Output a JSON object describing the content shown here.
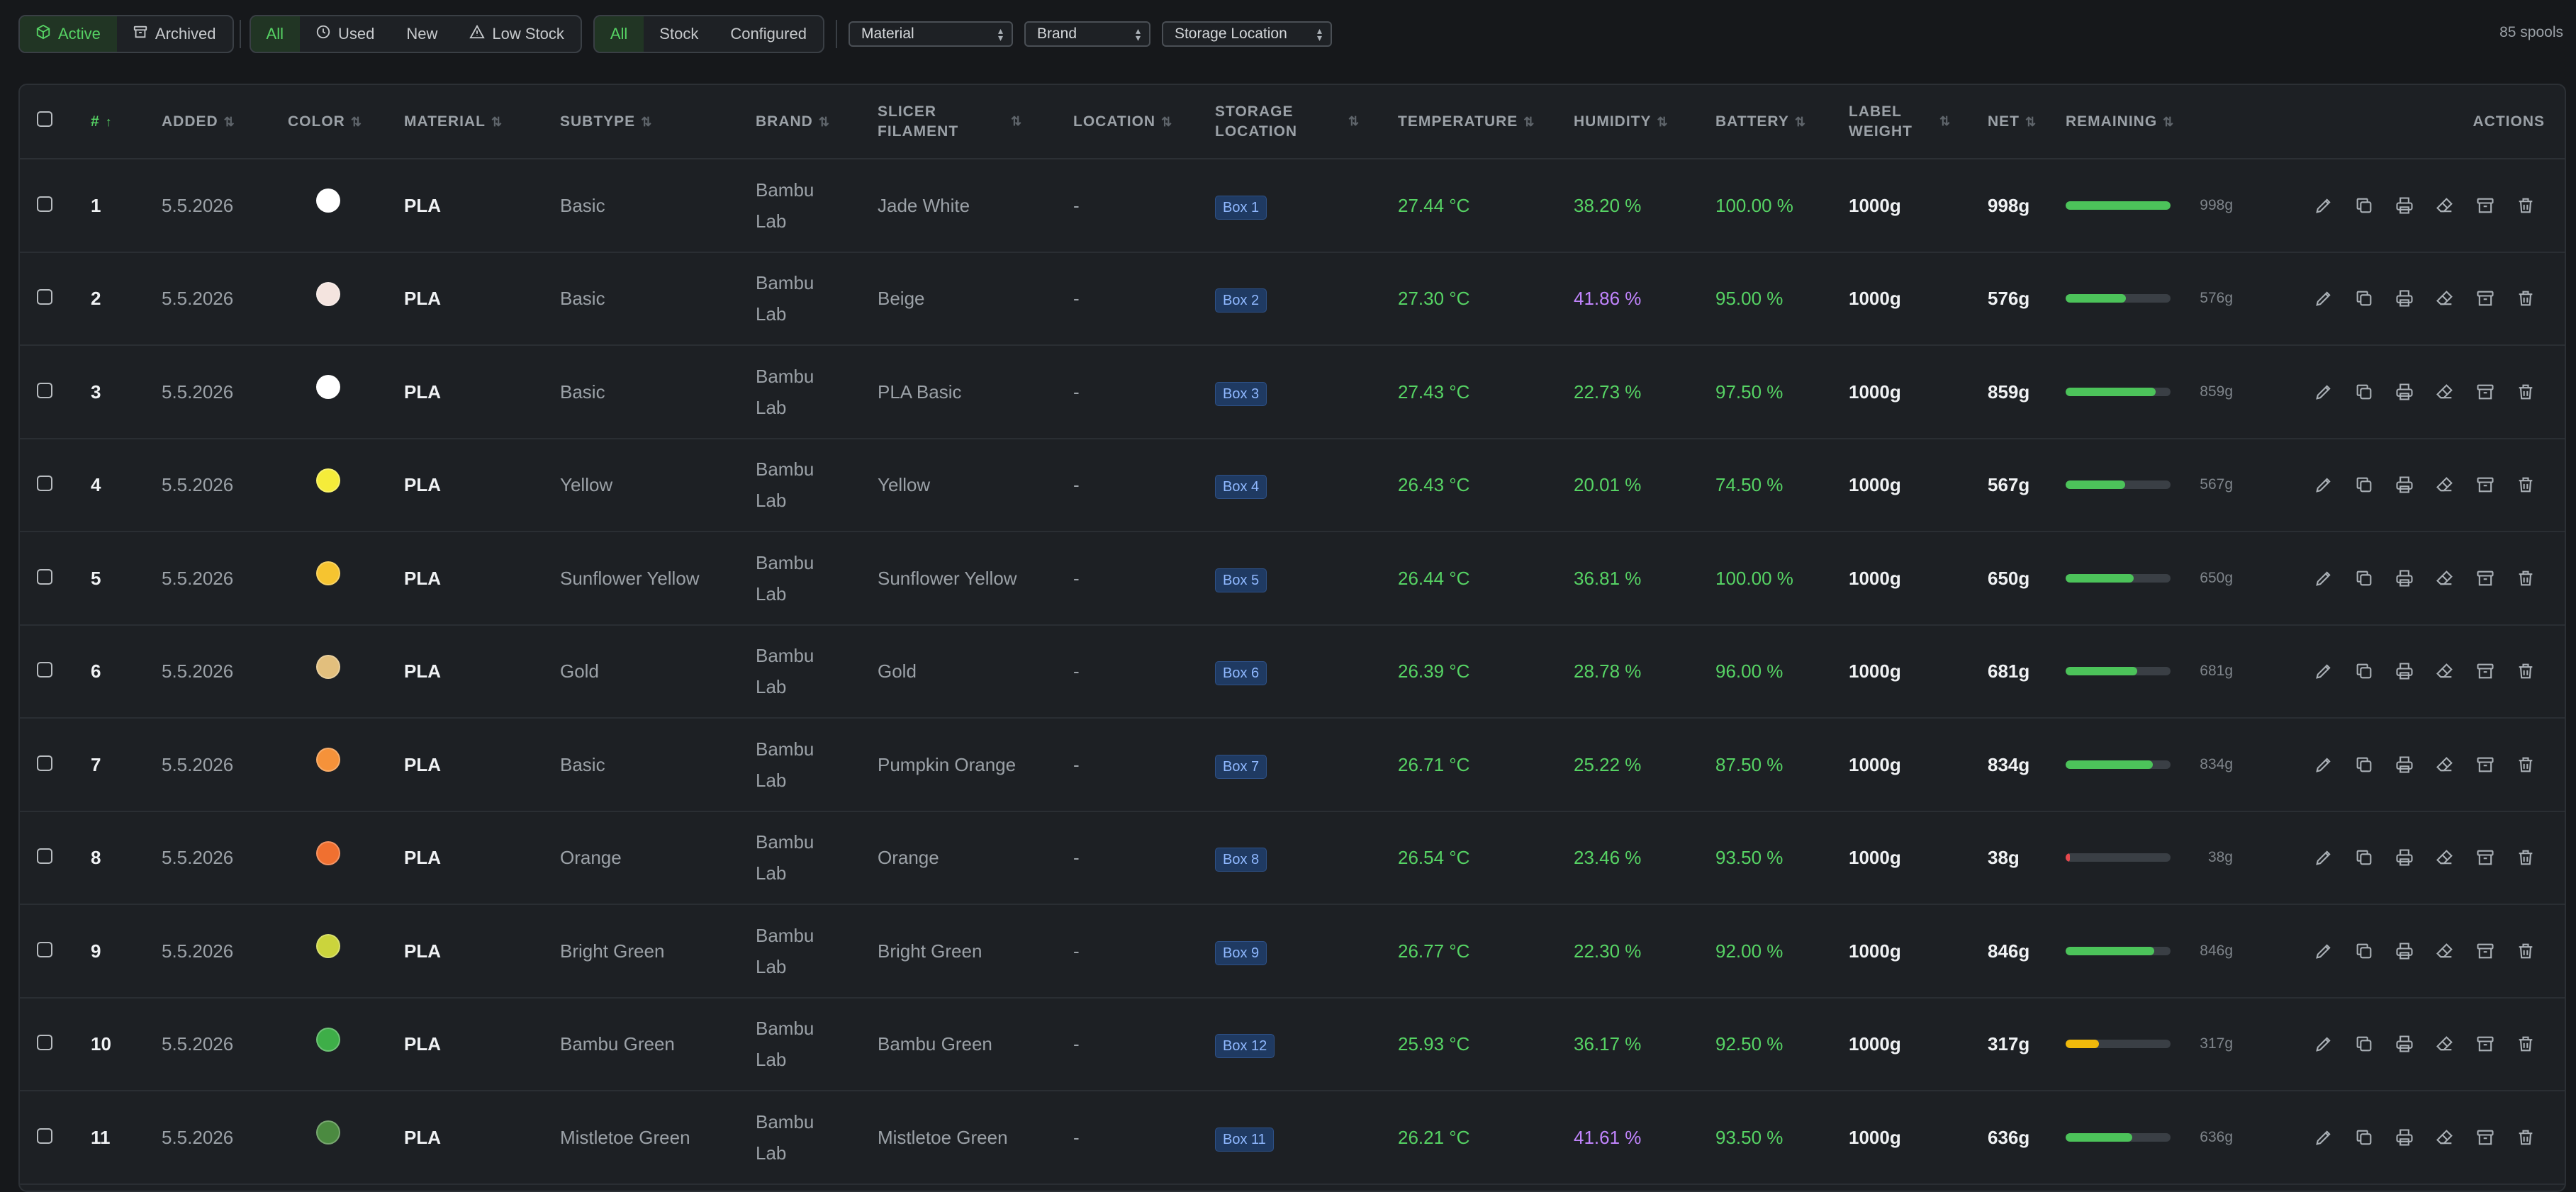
{
  "filters": {
    "status": [
      {
        "label": "Active",
        "icon": "cube-icon",
        "active": true
      },
      {
        "label": "Archived",
        "icon": "archive-icon",
        "active": false
      }
    ],
    "usage": [
      {
        "label": "All",
        "icon": "",
        "active": true
      },
      {
        "label": "Used",
        "icon": "clock-icon",
        "active": false
      },
      {
        "label": "New",
        "icon": "",
        "active": false
      },
      {
        "label": "Low Stock",
        "icon": "warning-icon",
        "active": false
      }
    ],
    "config": [
      {
        "label": "All",
        "active": true
      },
      {
        "label": "Stock",
        "active": false
      },
      {
        "label": "Configured",
        "active": false
      }
    ],
    "selects": [
      {
        "label": "Material"
      },
      {
        "label": "Brand"
      },
      {
        "label": "Storage Location"
      }
    ],
    "count": "85 spools"
  },
  "columns": {
    "id": "#",
    "added": "Added",
    "color": "Color",
    "material": "Material",
    "subtype": "Subtype",
    "brand": "Brand",
    "slicer": "Slicer Filament",
    "location": "Location",
    "storage": "Storage Location",
    "temperature": "Temperature",
    "humidity": "Humidity",
    "battery": "Battery",
    "label_weight": "Label Weight",
    "net": "Net",
    "remaining": "Remaining",
    "actions": "Actions"
  },
  "colors": {
    "accent": "#56d364",
    "humidity_high": "#c084fc",
    "bar_ok": "#4cc35a",
    "bar_warn": "#f0b90b",
    "bar_low": "#e5484d"
  },
  "rows": [
    {
      "id": "1",
      "added": "5.5.2026",
      "color": "#ffffff",
      "material": "PLA",
      "subtype": "Basic",
      "brand": "Bambu Lab",
      "slicer": "Jade White",
      "location": "-",
      "storage": "Box 1",
      "temperature": "27.44 °C",
      "humidity": "38.20 %",
      "hum_high": false,
      "battery": "100.00 %",
      "label_weight": "1000g",
      "net": "998g",
      "remaining": 0.998,
      "remaining_label": "998g"
    },
    {
      "id": "2",
      "added": "5.5.2026",
      "color": "#f4e4df",
      "material": "PLA",
      "subtype": "Basic",
      "brand": "Bambu Lab",
      "slicer": "Beige",
      "location": "-",
      "storage": "Box 2",
      "temperature": "27.30 °C",
      "humidity": "41.86 %",
      "hum_high": true,
      "battery": "95.00 %",
      "label_weight": "1000g",
      "net": "576g",
      "remaining": 0.576,
      "remaining_label": "576g"
    },
    {
      "id": "3",
      "added": "5.5.2026",
      "color": "#ffffff",
      "material": "PLA",
      "subtype": "Basic",
      "brand": "Bambu Lab",
      "slicer": "PLA Basic",
      "location": "-",
      "storage": "Box 3",
      "temperature": "27.43 °C",
      "humidity": "22.73 %",
      "hum_high": false,
      "battery": "97.50 %",
      "label_weight": "1000g",
      "net": "859g",
      "remaining": 0.859,
      "remaining_label": "859g"
    },
    {
      "id": "4",
      "added": "5.5.2026",
      "color": "#f5ec3a",
      "material": "PLA",
      "subtype": "Yellow",
      "brand": "Bambu Lab",
      "slicer": "Yellow",
      "location": "-",
      "storage": "Box 4",
      "temperature": "26.43 °C",
      "humidity": "20.01 %",
      "hum_high": false,
      "battery": "74.50 %",
      "label_weight": "1000g",
      "net": "567g",
      "remaining": 0.567,
      "remaining_label": "567g"
    },
    {
      "id": "5",
      "added": "5.5.2026",
      "color": "#f6c430",
      "material": "PLA",
      "subtype": "Sunflower Yellow",
      "brand": "Bambu Lab",
      "slicer": "Sunflower Yellow",
      "location": "-",
      "storage": "Box 5",
      "temperature": "26.44 °C",
      "humidity": "36.81 %",
      "hum_high": false,
      "battery": "100.00 %",
      "label_weight": "1000g",
      "net": "650g",
      "remaining": 0.65,
      "remaining_label": "650g"
    },
    {
      "id": "6",
      "added": "5.5.2026",
      "color": "#e2bf7d",
      "material": "PLA",
      "subtype": "Gold",
      "brand": "Bambu Lab",
      "slicer": "Gold",
      "location": "-",
      "storage": "Box 6",
      "temperature": "26.39 °C",
      "humidity": "28.78 %",
      "hum_high": false,
      "battery": "96.00 %",
      "label_weight": "1000g",
      "net": "681g",
      "remaining": 0.681,
      "remaining_label": "681g"
    },
    {
      "id": "7",
      "added": "5.5.2026",
      "color": "#f5923a",
      "material": "PLA",
      "subtype": "Basic",
      "brand": "Bambu Lab",
      "slicer": "Pumpkin Orange",
      "location": "-",
      "storage": "Box 7",
      "temperature": "26.71 °C",
      "humidity": "25.22 %",
      "hum_high": false,
      "battery": "87.50 %",
      "label_weight": "1000g",
      "net": "834g",
      "remaining": 0.834,
      "remaining_label": "834g"
    },
    {
      "id": "8",
      "added": "5.5.2026",
      "color": "#f07030",
      "material": "PLA",
      "subtype": "Orange",
      "brand": "Bambu Lab",
      "slicer": "Orange",
      "location": "-",
      "storage": "Box 8",
      "temperature": "26.54 °C",
      "humidity": "23.46 %",
      "hum_high": false,
      "battery": "93.50 %",
      "label_weight": "1000g",
      "net": "38g",
      "remaining": 0.038,
      "remaining_label": "38g"
    },
    {
      "id": "9",
      "added": "5.5.2026",
      "color": "#cbd43c",
      "material": "PLA",
      "subtype": "Bright Green",
      "brand": "Bambu Lab",
      "slicer": "Bright Green",
      "location": "-",
      "storage": "Box 9",
      "temperature": "26.77 °C",
      "humidity": "22.30 %",
      "hum_high": false,
      "battery": "92.00 %",
      "label_weight": "1000g",
      "net": "846g",
      "remaining": 0.846,
      "remaining_label": "846g"
    },
    {
      "id": "10",
      "added": "5.5.2026",
      "color": "#3eae48",
      "material": "PLA",
      "subtype": "Bambu Green",
      "brand": "Bambu Lab",
      "slicer": "Bambu Green",
      "location": "-",
      "storage": "Box 12",
      "temperature": "25.93 °C",
      "humidity": "36.17 %",
      "hum_high": false,
      "battery": "92.50 %",
      "label_weight": "1000g",
      "net": "317g",
      "remaining": 0.317,
      "remaining_label": "317g"
    },
    {
      "id": "11",
      "added": "5.5.2026",
      "color": "#4b8a40",
      "material": "PLA",
      "subtype": "Mistletoe Green",
      "brand": "Bambu Lab",
      "slicer": "Mistletoe Green",
      "location": "-",
      "storage": "Box 11",
      "temperature": "26.21 °C",
      "humidity": "41.61 %",
      "hum_high": true,
      "battery": "93.50 %",
      "label_weight": "1000g",
      "net": "636g",
      "remaining": 0.636,
      "remaining_label": "636g"
    }
  ]
}
